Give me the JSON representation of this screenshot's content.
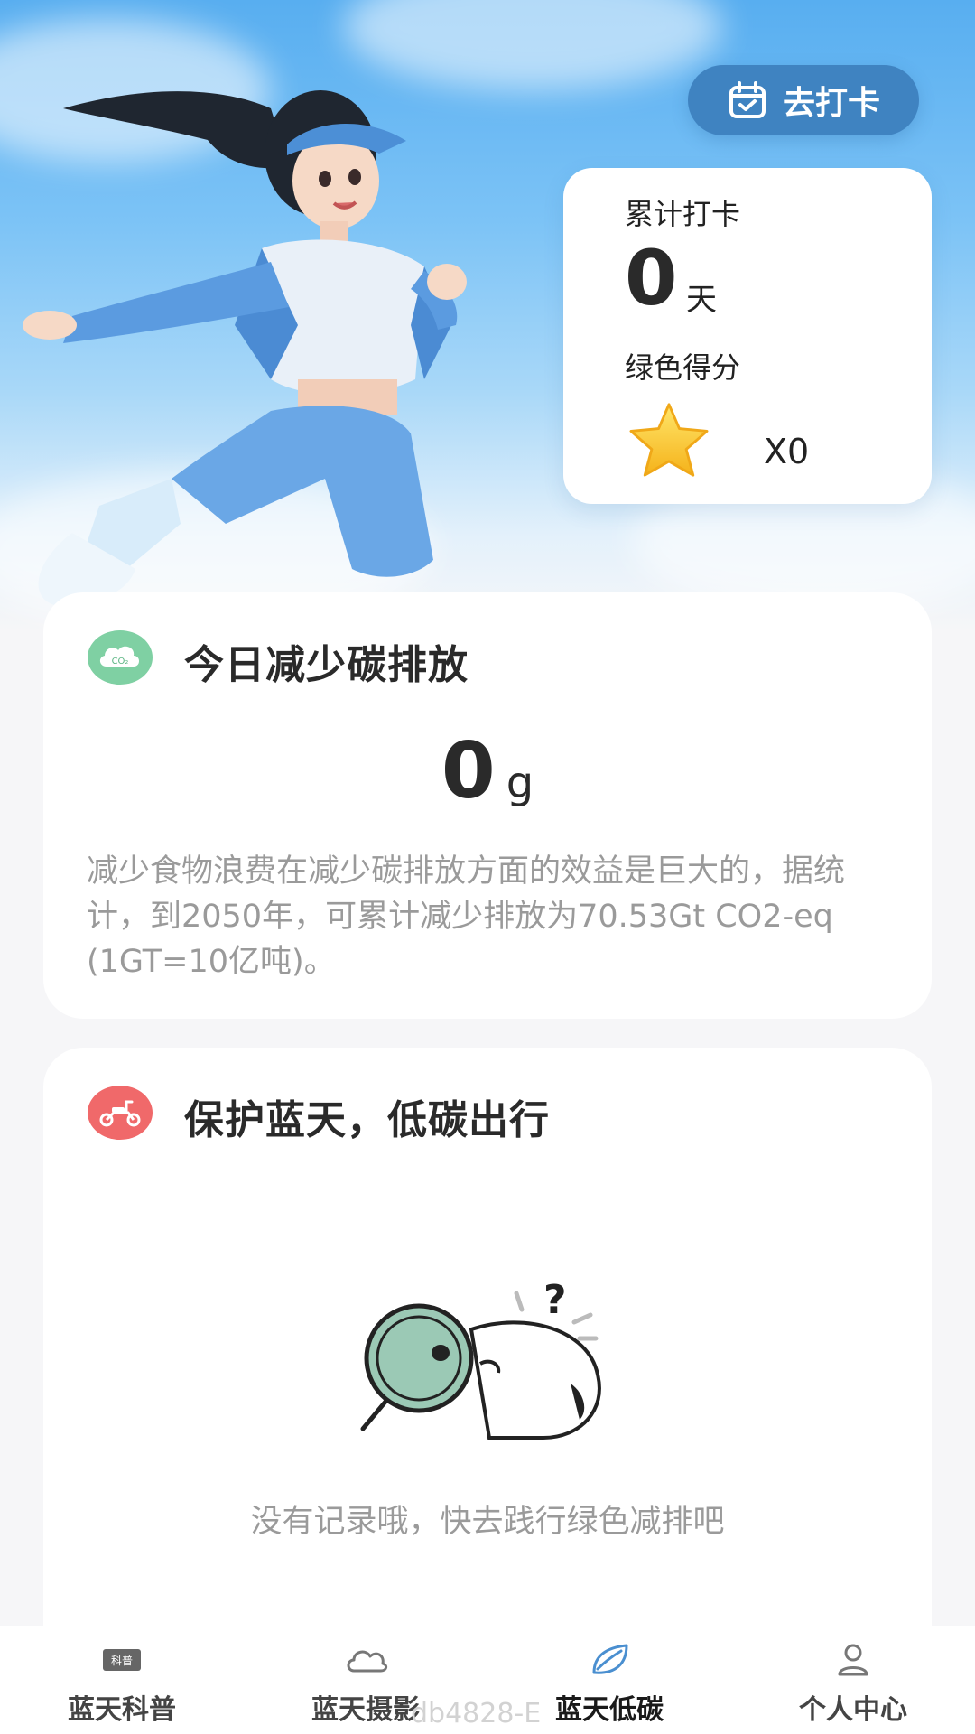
{
  "header": {
    "checkin_label": "去打卡"
  },
  "stats": {
    "total_checkin_label": "累计打卡",
    "days_value": "0",
    "days_unit": "天",
    "green_score_label": "绿色得分",
    "score_value": "X0"
  },
  "carbon_card": {
    "icon_text": "CO₂",
    "title": "今日减少碳排放",
    "value": "0",
    "unit": "g",
    "description": "减少食物浪费在减少碳排放方面的效益是巨大的，据统计，到2050年，可累计减少排放为70.53Gt CO2-eq (1GT=10亿吨)。"
  },
  "travel_card": {
    "title": "保护蓝天，低碳出行",
    "empty_text": "没有记录哦，快去践行绿色减排吧"
  },
  "nav": {
    "items": [
      {
        "label": "蓝天科普",
        "icon": "book-icon",
        "icon_text": "科普"
      },
      {
        "label": "蓝天摄影",
        "icon": "cloud-icon"
      },
      {
        "label": "蓝天低碳",
        "icon": "leaf-icon",
        "active": true
      },
      {
        "label": "个人中心",
        "icon": "user-icon"
      }
    ]
  },
  "watermark": "db4828-E",
  "colors": {
    "accent": "#3f83c1",
    "co2_icon": "#7fd0a3",
    "scooter_icon": "#f0696a",
    "leaf_active": "#4a8fd0"
  }
}
